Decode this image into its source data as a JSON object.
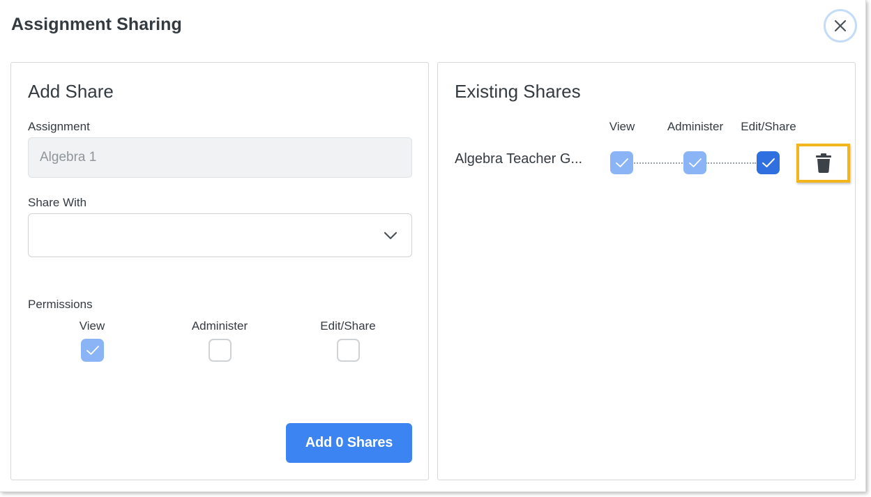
{
  "dialog": {
    "title": "Assignment Sharing",
    "close_icon": "close-icon"
  },
  "add_share": {
    "title": "Add Share",
    "assignment_label": "Assignment",
    "assignment_value": "Algebra 1",
    "share_with_label": "Share With",
    "share_with_value": "",
    "share_with_icon": "chevron-down-icon",
    "permissions_label": "Permissions",
    "permissions": [
      {
        "label": "View",
        "checked": true
      },
      {
        "label": "Administer",
        "checked": false
      },
      {
        "label": "Edit/Share",
        "checked": false
      }
    ],
    "add_button_label": "Add 0 Shares"
  },
  "existing_shares": {
    "title": "Existing Shares",
    "columns": [
      "View",
      "Administer",
      "Edit/Share"
    ],
    "rows": [
      {
        "name": "Algebra Teacher G...",
        "view": true,
        "administer": true,
        "edit_share": true,
        "delete_icon": "trash-icon"
      }
    ]
  },
  "colors": {
    "primary": "#3b84f2",
    "checkbox_light": "#8ab4f5",
    "checkbox_dark": "#2f6fe0",
    "highlight": "#f2b51e",
    "close_ring": "#c4dcf7"
  }
}
